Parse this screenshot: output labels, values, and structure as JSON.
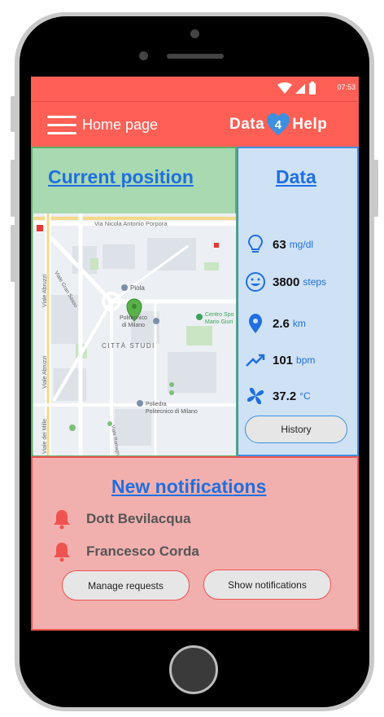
{
  "status_bar": {
    "time": "07:53"
  },
  "header": {
    "title": "Home page",
    "logo": {
      "left": "Data",
      "number": "4",
      "right": "Help"
    }
  },
  "position_panel": {
    "heading": "Current position",
    "map_labels": {
      "street_top": "Via Nicola Antonio Porpora",
      "street_gran_sasso": "Viale Gran Sasso",
      "street_abruzzi": "Viale Abruzzi",
      "street_abruzzi_lower": "Viale Abruzzi",
      "street_dei_mille": "Viale dei Mille",
      "street_romagna": "Viale Romagna",
      "poi_piola": "Piola",
      "poi_polimi_1": "Politecnico",
      "poi_polimi_2": "di Milano",
      "poi_centro_1": "Centro Spo",
      "poi_centro_2": "Mario Giuri",
      "district": "CITTÀ STUDI",
      "poi_poliedra_1": "Poliedra",
      "poi_poliedra_2": "Politecnico di Milano"
    }
  },
  "data_panel": {
    "heading": "Data",
    "metrics": [
      {
        "icon": "lightbulb-icon",
        "value": "63",
        "unit": "mg/dl"
      },
      {
        "icon": "smiley-icon",
        "value": "3800",
        "unit": "steps"
      },
      {
        "icon": "location-pin-icon",
        "value": "2.6",
        "unit": "km"
      },
      {
        "icon": "trending-up-icon",
        "value": "101",
        "unit": "bpm"
      },
      {
        "icon": "fan-icon",
        "value": "37.2",
        "unit": "°C"
      }
    ],
    "history_label": "History"
  },
  "notifications_panel": {
    "heading": "New notifications",
    "items": [
      {
        "name": "Dott Bevilacqua"
      },
      {
        "name": "Francesco Corda"
      }
    ],
    "manage_label": "Manage requests",
    "show_label": "Show notifications"
  },
  "colors": {
    "accent_red": "#ff5f55",
    "link_blue": "#1f6fe0",
    "position_bg": "#a8d9b1",
    "data_bg": "#cfe1f5",
    "notif_bg": "#f1b0ae"
  }
}
